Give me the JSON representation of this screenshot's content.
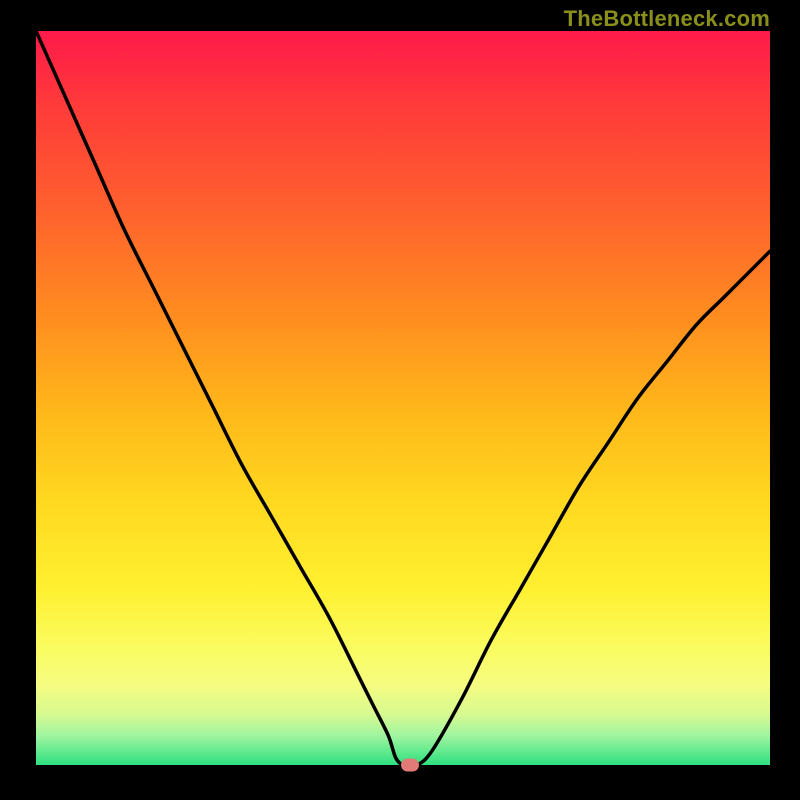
{
  "watermark": "TheBottleneck.com",
  "colors": {
    "frame_bg": "#000000",
    "gradient_top": "#ff1a4a",
    "gradient_bottom": "#2ee080",
    "curve_stroke": "#000000",
    "marker_fill": "#e27a78"
  },
  "chart_data": {
    "type": "line",
    "title": "",
    "xlabel": "",
    "ylabel": "",
    "xlim": [
      0,
      100
    ],
    "ylim": [
      0,
      100
    ],
    "grid": false,
    "legend": false,
    "series": [
      {
        "name": "curve",
        "x": [
          0,
          4,
          8,
          12,
          16,
          20,
          24,
          28,
          32,
          36,
          40,
          44,
          46,
          48,
          49,
          50,
          51,
          52,
          54,
          58,
          62,
          66,
          70,
          74,
          78,
          82,
          86,
          90,
          94,
          100
        ],
        "y": [
          100,
          91,
          82,
          73,
          65,
          57,
          49,
          41,
          34,
          27,
          20,
          12,
          8,
          4,
          1,
          0,
          0,
          0,
          2,
          9,
          17,
          24,
          31,
          38,
          44,
          50,
          55,
          60,
          64,
          70
        ]
      }
    ],
    "marker": {
      "x": 51,
      "y": 0
    }
  }
}
